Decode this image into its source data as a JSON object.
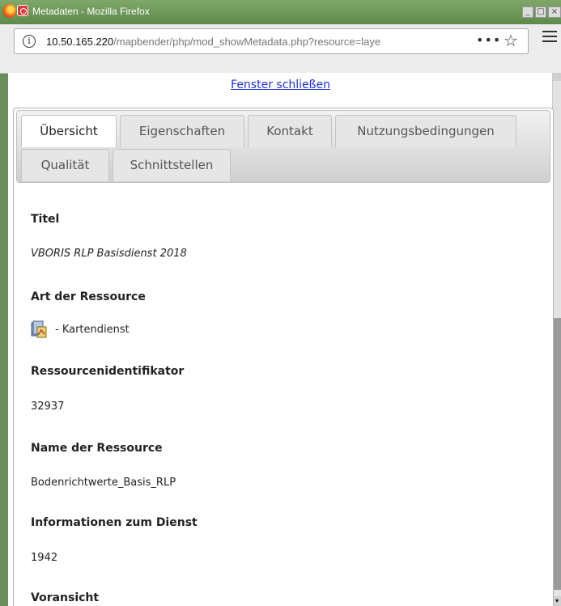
{
  "window": {
    "title": "Metadaten - Mozilla Firefox"
  },
  "browser": {
    "url_host": "10.50.165.220",
    "url_path": "/mapbender/php/mod_showMetadata.php?resource=laye",
    "more_label": "•••",
    "star_glyph": "☆"
  },
  "page": {
    "close_link": "Fenster schließen",
    "tabs": [
      "Übersicht",
      "Eigenschaften",
      "Kontakt",
      "Nutzungsbedingungen",
      "Qualität",
      "Schnittstellen"
    ],
    "sections": [
      {
        "label": "Titel",
        "value": "VBORIS RLP Basisdienst 2018"
      },
      {
        "label": "Art der Ressource",
        "value": "- Kartendienst",
        "icon": "map-service-icon"
      },
      {
        "label": "Ressourcenidentifikator",
        "value": "32937"
      },
      {
        "label": "Name der Ressource",
        "value": "Bodenrichtwerte_Basis_RLP"
      },
      {
        "label": "Informationen zum Dienst",
        "value": "1942"
      },
      {
        "label": "Voransicht",
        "value": ""
      }
    ]
  },
  "colors": {
    "link": "#1a33d6",
    "titlebar": "#6a9a55"
  }
}
